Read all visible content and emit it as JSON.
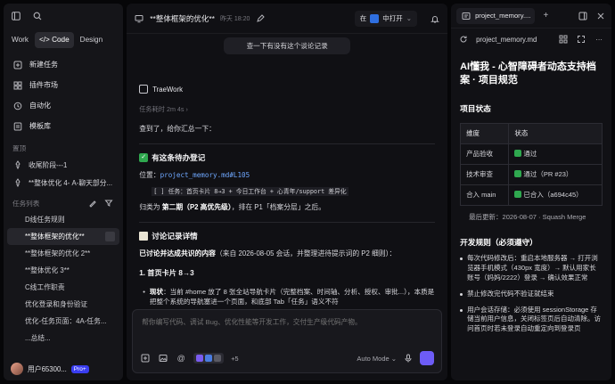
{
  "sidebar": {
    "modes": [
      "Work",
      "</> Code",
      "Design"
    ],
    "nav": [
      "新建任务",
      "插件市场",
      "自动化",
      "模板库"
    ],
    "pinned_label": "置顶",
    "pinned": [
      "收尾阶段---1",
      "**整体优化 4- A-聊天部分..."
    ],
    "tasks_label": "任务列表",
    "tasks": [
      "D线任务规则",
      "**整体框架的优化**",
      "**整体框架的优化 2**",
      "**整体优化 3**",
      "C线工作职责",
      "优化登录和身份验证",
      "优化-任务页面：4A-任务...",
      "...总结..."
    ],
    "user": "用户65300...",
    "plan": "Pro+"
  },
  "chat": {
    "title": "**整体框架的优化**",
    "time": "昨天 18:20",
    "open_in_prefix": "在",
    "open_in_label": "中打开",
    "user_message": "查一下有没有这个谈论记录",
    "agent_name": "TraeWork",
    "elapsed": "任务耗时 2m 4s",
    "intro": "查到了，给你汇总一下：",
    "section1_title": "有这条待办登记",
    "location_prefix": "位置：",
    "location_link": "project_memory.md#L105",
    "todo_line": "[ ] 任务：首页卡片 8→3 + 今日工作台 + 心青年/support 差异化",
    "classify_prefix": "归类为",
    "classify_bold": "第二期（P2 高优先级）",
    "classify_suffix": "，排在 P1「档案分层」之后。",
    "section2_title": "讨论记录详情",
    "record_prefix": "已讨论并达成共识的内容",
    "record_suffix": "（来自 2026-08-05 会话，并整理进待提示词的 P2 细则）：",
    "sub1": "1. 首页卡片 8→3",
    "bullet1_label": "现状",
    "bullet1_text": "：当前 #home 放了 8 张全站导航卡片（完整档案、时间轴、分析、授权、审批...），本质是把整个系统的导航塞进一个页面，和底部 Tab「任务」语义不符",
    "composer_placeholder": "帮你编写代码、调试 Bug、优化性能等开发工作，交付生产级代码产物。",
    "plus_count": "+5",
    "auto_mode": "Auto Mode"
  },
  "doc": {
    "tab": "project_memory....",
    "file": "project_memory.md",
    "title": "AI懂我 - 心智障碍者动态支持档案 · 项目规范",
    "status_heading": "项目状态",
    "table_headers": [
      "维度",
      "状态"
    ],
    "table_rows": [
      [
        "产品验收",
        "通过"
      ],
      [
        "技术审查",
        "通过（PR #23）"
      ],
      [
        "合入 main",
        "已合入（a694c45）"
      ]
    ],
    "updated": "最后更新：2026-08-07 · Squash Merge",
    "rules_heading": "开发规则（必须遵守）",
    "rule1": "每次代码修改后：重启本地服务器 → 打开浏览器手机模式（430px 宽度）→ 默认用家长账号（妈妈/2222）登录 → 确认效果正常",
    "rule2": "禁止修改完代码不验证就结束",
    "rule3": "用户会话存储：必须使用 sessionStorage 存储当前用户信息，关闭标签页后自动清除。访问首页时若未登录自动重定向到登录页"
  },
  "colors": {
    "accent": "#6d5cf6",
    "link": "#6fa8ff",
    "success": "#2fa84f",
    "pro": "#3a3df0"
  }
}
